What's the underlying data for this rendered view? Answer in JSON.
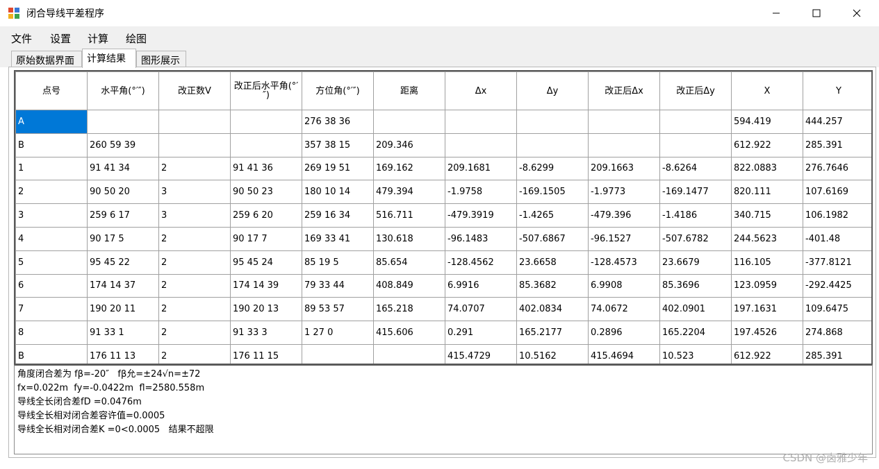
{
  "window": {
    "title": "闭合导线平差程序",
    "icon": "app-icon"
  },
  "menu": [
    "文件",
    "设置",
    "计算",
    "绘图"
  ],
  "tabs": [
    {
      "label": "原始数据界面",
      "active": false
    },
    {
      "label": "计算结果",
      "active": true
    },
    {
      "label": "图形展示",
      "active": false
    }
  ],
  "table": {
    "headers": [
      "点号",
      "水平角(°′″)",
      "改正数V",
      "改正后水平角(°′″)",
      "方位角(°′″)",
      "距离",
      "Δx",
      "Δy",
      "改正后Δx",
      "改正后Δy",
      "X",
      "Y"
    ],
    "rows": [
      [
        "A",
        "",
        "",
        "",
        "276 38 36",
        "",
        "",
        "",
        "",
        "",
        "594.419",
        "444.257"
      ],
      [
        "B",
        "260 59 39",
        "",
        "",
        "357 38 15",
        "209.346",
        "",
        "",
        "",
        "",
        "612.922",
        "285.391"
      ],
      [
        "1",
        "91 41 34",
        "2",
        "91 41 36",
        "269 19 51",
        "169.162",
        "209.1681",
        "-8.6299",
        "209.1663",
        "-8.6264",
        "822.0883",
        "276.7646"
      ],
      [
        "2",
        "90 50 20",
        "3",
        "90 50 23",
        "180 10 14",
        "479.394",
        "-1.9758",
        "-169.1505",
        "-1.9773",
        "-169.1477",
        "820.111",
        "107.6169"
      ],
      [
        "3",
        "259 6 17",
        "3",
        "259 6 20",
        "259 16 34",
        "516.711",
        "-479.3919",
        "-1.4265",
        "-479.396",
        "-1.4186",
        "340.715",
        "106.1982"
      ],
      [
        "4",
        "90 17 5",
        "2",
        "90 17 7",
        "169 33 41",
        "130.618",
        "-96.1483",
        "-507.6867",
        "-96.1527",
        "-507.6782",
        "244.5623",
        "-401.48"
      ],
      [
        "5",
        "95 45 22",
        "2",
        "95 45 24",
        "85 19 5",
        "85.654",
        "-128.4562",
        "23.6658",
        "-128.4573",
        "23.6679",
        "116.105",
        "-377.8121"
      ],
      [
        "6",
        "174 14 37",
        "2",
        "174 14 39",
        "79 33 44",
        "408.849",
        "6.9916",
        "85.3682",
        "6.9908",
        "85.3696",
        "123.0959",
        "-292.4425"
      ],
      [
        "7",
        "190 20 11",
        "2",
        "190 20 13",
        "89 53 57",
        "165.218",
        "74.0707",
        "402.0834",
        "74.0672",
        "402.0901",
        "197.1631",
        "109.6475"
      ],
      [
        "8",
        "91 33 1",
        "2",
        "91 33 3",
        "1 27 0",
        "415.606",
        "0.291",
        "165.2177",
        "0.2896",
        "165.2204",
        "197.4526",
        "274.868"
      ],
      [
        "B",
        "176 11 13",
        "2",
        "176 11 15",
        "",
        "",
        "415.4729",
        "10.5162",
        "415.4694",
        "10.523",
        "612.922",
        "285.391"
      ]
    ]
  },
  "results": [
    "角度闭合差为 fβ=-20″   fβ允=±24√n=±72",
    "fx=0.022m  fy=-0.0422m  fl=2580.558m",
    "导线全长闭合差fD =0.0476m",
    "导线全长相对闭合差容许值=0.0005",
    "导线全长相对闭合差K =0<0.0005   结果不超限"
  ],
  "watermark": "CSDN @卤雅少年",
  "colors": {
    "selection": "#0078d7"
  }
}
